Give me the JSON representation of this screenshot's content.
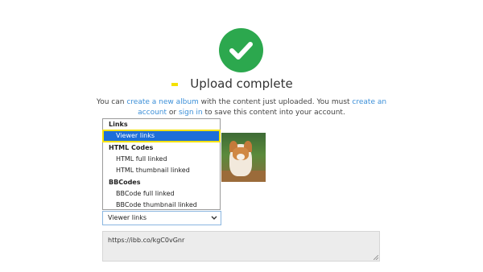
{
  "header": {
    "title": "Upload complete",
    "status_icon": "check-icon",
    "status_color": "#2ca84e"
  },
  "description": {
    "part1": "You can ",
    "create_album_link": "create a new album",
    "part2": " with the content just uploaded. You must ",
    "create_account_link": "create an account",
    "part3": " or ",
    "sign_in_link": "sign in",
    "part4": " to save this content into your account.",
    "link_color": "#3b8fd8"
  },
  "dropdown": {
    "groups": [
      {
        "label": "Links",
        "options": [
          "Viewer links"
        ]
      },
      {
        "label": "HTML Codes",
        "options": [
          "HTML full linked",
          "HTML thumbnail linked"
        ]
      },
      {
        "label": "BBCodes",
        "options": [
          "BBCode full linked",
          "BBCode thumbnail linked"
        ]
      }
    ],
    "highlighted": "Viewer links",
    "highlight_color": "#1e6ed8"
  },
  "select": {
    "value": "Viewer links"
  },
  "output": {
    "text": "https://ibb.co/kgC0vGnr"
  }
}
